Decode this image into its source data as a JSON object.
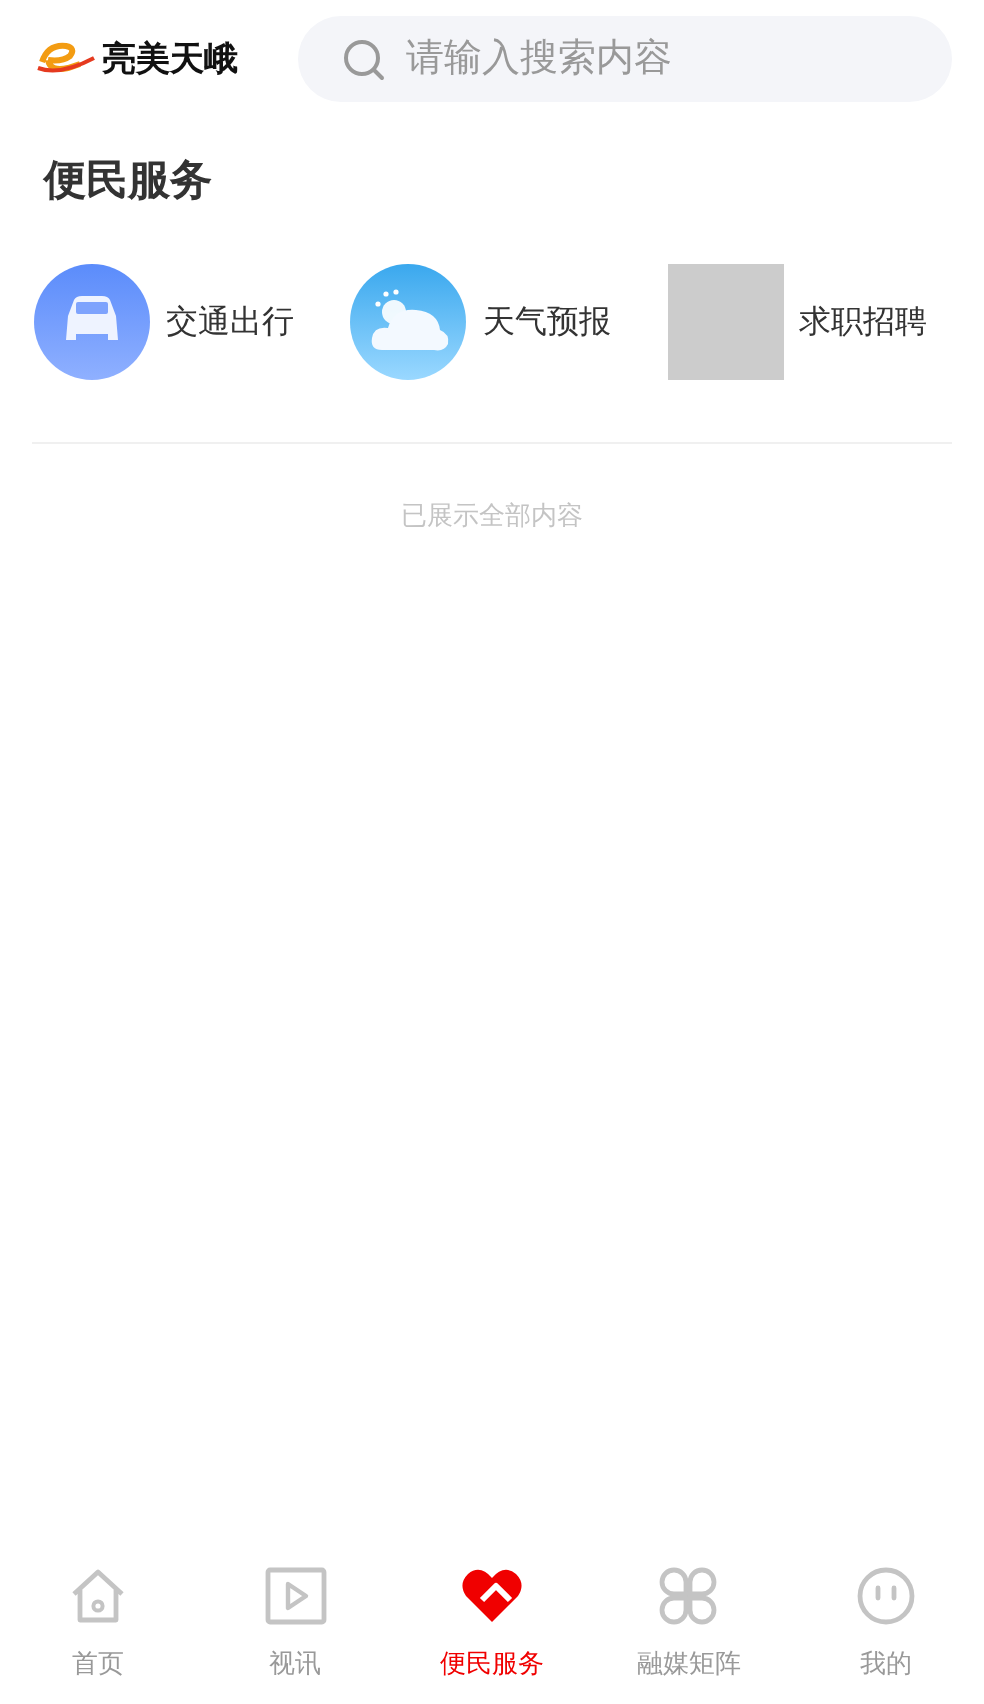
{
  "header": {
    "logo_text": "亮美天峨",
    "search": {
      "placeholder": "请输入搜索内容"
    }
  },
  "section": {
    "title": "便民服务"
  },
  "services": [
    {
      "label": "交通出行",
      "kind": "car"
    },
    {
      "label": "天气预报",
      "kind": "weather"
    },
    {
      "label": "求职招聘",
      "kind": "placeholder"
    }
  ],
  "end_note": "已展示全部内容",
  "tabs": [
    {
      "label": "首页",
      "kind": "home",
      "selected": false
    },
    {
      "label": "视讯",
      "kind": "video",
      "selected": false
    },
    {
      "label": "便民服务",
      "kind": "heart",
      "selected": true
    },
    {
      "label": "融媒矩阵",
      "kind": "clover",
      "selected": false
    },
    {
      "label": "我的",
      "kind": "face",
      "selected": false
    }
  ]
}
